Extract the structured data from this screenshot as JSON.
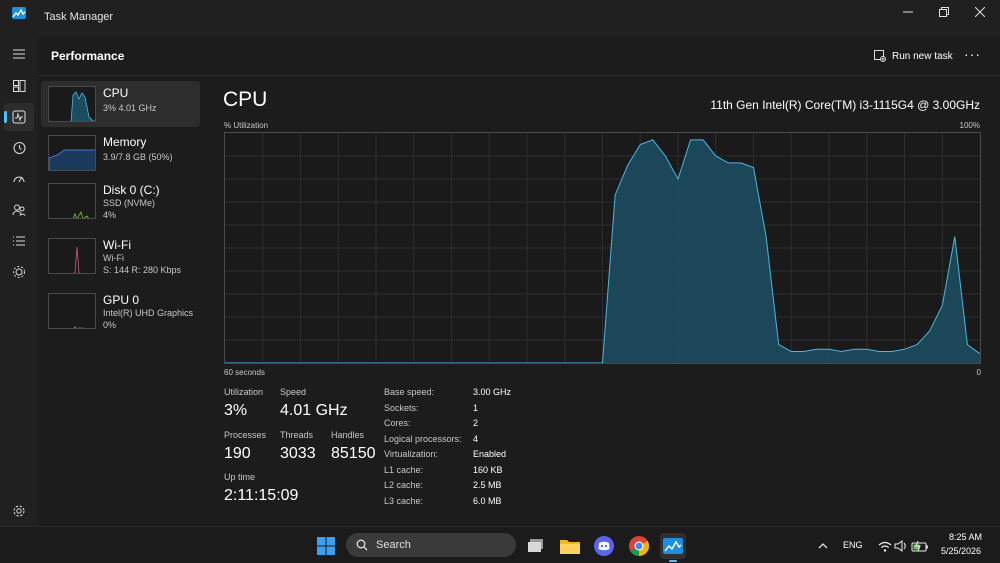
{
  "window": {
    "title": "Task Manager"
  },
  "header": {
    "title": "Performance",
    "run_new_task": "Run new task",
    "more": "···"
  },
  "devices": [
    {
      "name": "CPU",
      "line1": "3%  4.01 GHz",
      "line2": "",
      "color": "#4fb6e0"
    },
    {
      "name": "Memory",
      "line1": "3.9/7.8 GB (50%)",
      "line2": "",
      "color": "#4f8fe0"
    },
    {
      "name": "Disk 0 (C:)",
      "line1": "SSD (NVMe)",
      "line2": "4%",
      "color": "#7fbf3f"
    },
    {
      "name": "Wi-Fi",
      "line1": "Wi-Fi",
      "line2": "S: 144  R: 280 Kbps",
      "color": "#e0507a"
    },
    {
      "name": "GPU 0",
      "line1": "Intel(R) UHD Graphics",
      "line2": "0%",
      "color": "#a070e0"
    }
  ],
  "detail": {
    "title": "CPU",
    "model": "11th Gen Intel(R) Core(TM) i3-1115G4 @ 3.00GHz",
    "y_label": "% Utilization",
    "y_max": "100%",
    "x_left": "60 seconds",
    "x_right": "0"
  },
  "chart_data": {
    "type": "area",
    "x": [
      60,
      59,
      58,
      57,
      56,
      55,
      54,
      53,
      52,
      51,
      50,
      49,
      48,
      47,
      46,
      45,
      44,
      43,
      42,
      41,
      40,
      39,
      38,
      37,
      36,
      35,
      34,
      33,
      32,
      31,
      30,
      29,
      28,
      27,
      26,
      25,
      24,
      23,
      22,
      21,
      20,
      19,
      18,
      17,
      16,
      15,
      14,
      13,
      12,
      11,
      10,
      9,
      8,
      7,
      6,
      5,
      4,
      3,
      2,
      1,
      0
    ],
    "values": [
      0,
      0,
      0,
      0,
      0,
      0,
      0,
      0,
      0,
      0,
      0,
      0,
      0,
      0,
      0,
      0,
      0,
      0,
      0,
      0,
      0,
      0,
      0,
      0,
      0,
      0,
      0,
      0,
      0,
      0,
      0,
      73,
      86,
      95,
      97,
      90,
      80,
      97,
      97,
      90,
      87,
      87,
      85,
      55,
      8,
      5,
      5,
      6,
      6,
      5,
      6,
      6,
      5,
      5,
      6,
      8,
      14,
      25,
      55,
      8,
      4
    ],
    "xlabel": "60 seconds",
    "ylabel": "% Utilization",
    "ylim": [
      0,
      100
    ],
    "grid": true,
    "color": "#4fb6e0"
  },
  "stats": {
    "utilization_label": "Utilization",
    "utilization": "3%",
    "speed_label": "Speed",
    "speed": "4.01 GHz",
    "processes_label": "Processes",
    "processes": "190",
    "threads_label": "Threads",
    "threads": "3033",
    "handles_label": "Handles",
    "handles": "85150",
    "uptime_label": "Up time",
    "uptime": "2:11:15:09"
  },
  "specs": [
    {
      "label": "Base speed:",
      "value": "3.00 GHz"
    },
    {
      "label": "Sockets:",
      "value": "1"
    },
    {
      "label": "Cores:",
      "value": "2"
    },
    {
      "label": "Logical processors:",
      "value": "4"
    },
    {
      "label": "Virtualization:",
      "value": "Enabled"
    },
    {
      "label": "L1 cache:",
      "value": "160 KB"
    },
    {
      "label": "L2 cache:",
      "value": "2.5 MB"
    },
    {
      "label": "L3 cache:",
      "value": "6.0 MB"
    }
  ],
  "taskbar": {
    "search_placeholder": "Search",
    "lang": "ENG",
    "time": "8:25 AM",
    "date": "5/25/2026"
  }
}
